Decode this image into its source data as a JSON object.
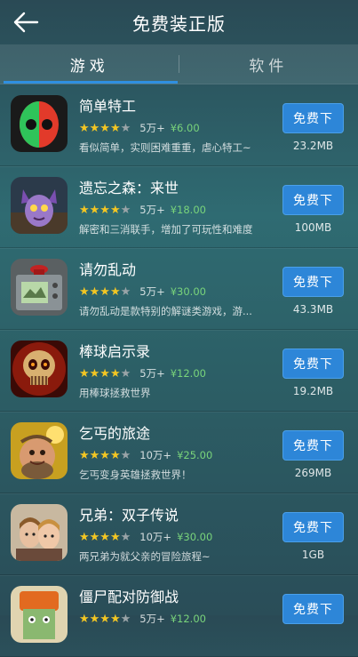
{
  "header": {
    "title": "免费装正版"
  },
  "tabs": [
    {
      "label": "游戏"
    },
    {
      "label": "软件"
    }
  ],
  "apps": [
    {
      "name": "简单特工",
      "rating": 4,
      "downloads": "5万+",
      "price": "¥6.00",
      "desc": "看似简单，实则困难重重，虐心特工~",
      "button": "免费下",
      "size": "23.2MB",
      "icon": "spy-mask-icon"
    },
    {
      "name": "遗忘之森：来世",
      "rating": 4,
      "downloads": "5万+",
      "price": "¥18.00",
      "desc": "解密和三消联手，增加了可玩性和难度",
      "button": "免费下",
      "size": "100MB",
      "icon": "forest-creature-icon"
    },
    {
      "name": "请勿乱动",
      "rating": 4,
      "downloads": "5万+",
      "price": "¥30.00",
      "desc": "请勿乱动是款特别的解谜类游戏，游...",
      "button": "免费下",
      "size": "43.3MB",
      "icon": "red-button-box-icon"
    },
    {
      "name": "棒球启示录",
      "rating": 4,
      "downloads": "5万+",
      "price": "¥12.00",
      "desc": "用棒球拯救世界",
      "button": "免费下",
      "size": "19.2MB",
      "icon": "skull-icon"
    },
    {
      "name": "乞丐的旅途",
      "rating": 4,
      "downloads": "10万+",
      "price": "¥25.00",
      "desc": "乞丐变身英雄拯救世界！",
      "button": "免费下",
      "size": "269MB",
      "icon": "beggar-hero-icon"
    },
    {
      "name": "兄弟：双子传说",
      "rating": 4,
      "downloads": "10万+",
      "price": "¥30.00",
      "desc": "两兄弟为就父亲的冒险旅程~",
      "button": "免费下",
      "size": "1GB",
      "icon": "brothers-icon"
    },
    {
      "name": "僵尸配对防御战",
      "rating": 4,
      "downloads": "5万+",
      "price": "¥12.00",
      "desc": "",
      "button": "免费下",
      "size": "",
      "icon": "zombie-icon"
    }
  ],
  "colors": {
    "accent": "#2d86d8",
    "price": "#79d47b",
    "star": "#f3c623"
  }
}
